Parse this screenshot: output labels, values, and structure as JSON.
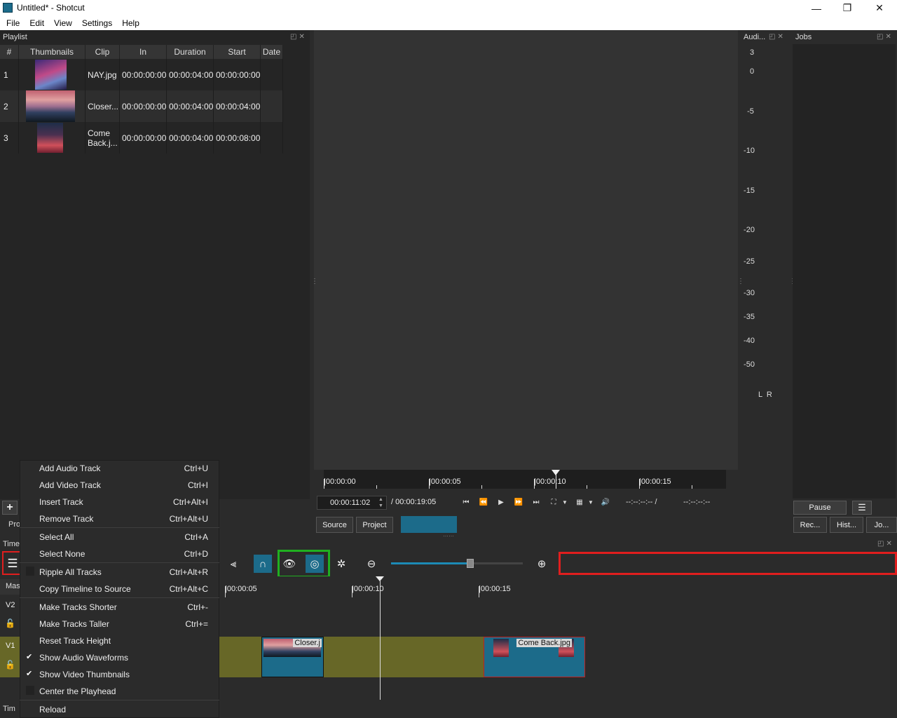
{
  "window": {
    "title": "Untitled* - Shotcut",
    "min": "—",
    "max": "❐",
    "close": "✕"
  },
  "menubar": [
    "File",
    "Edit",
    "View",
    "Settings",
    "Help"
  ],
  "playlist": {
    "title": "Playlist",
    "columns": [
      "#",
      "Thumbnails",
      "Clip",
      "In",
      "Duration",
      "Start",
      "Date"
    ],
    "rows": [
      {
        "num": "1",
        "clip": "NAY.jpg",
        "in": "00:00:00:00",
        "duration": "00:00:04:00",
        "start": "00:00:00:00"
      },
      {
        "num": "2",
        "clip": "Closer...",
        "in": "00:00:00:00",
        "duration": "00:00:04:00",
        "start": "00:00:04:00"
      },
      {
        "num": "3",
        "clip": "Come Back.j...",
        "in": "00:00:00:00",
        "duration": "00:00:04:00",
        "start": "00:00:08:00"
      }
    ],
    "add_label": "+",
    "tab_label": "Pro"
  },
  "audio_meter": {
    "title": "Audi...",
    "scale": [
      "3",
      "0",
      "-5",
      "-10",
      "-15",
      "-20",
      "-25",
      "-30",
      "-35",
      "-40",
      "-50"
    ],
    "channels": "L  R"
  },
  "jobs": {
    "title": "Jobs",
    "pause": "Pause",
    "menu": "☰",
    "tabs": [
      "Rec...",
      "Hist...",
      "Jo..."
    ]
  },
  "player": {
    "ruler_labels": [
      "|00:00:00",
      "|00:00:05",
      "|00:00:10",
      "|00:00:15"
    ],
    "position": "00:00:11:02",
    "duration": "/ 00:00:19:05",
    "in_out": "--:--:--:-- /",
    "out": "--:--:--:--",
    "tabs": [
      "Source",
      "Project"
    ]
  },
  "timeline": {
    "title": "Time",
    "master_label": "Mas",
    "tracks": [
      "V2",
      "V1"
    ],
    "ruler_labels": [
      "|00:00:05",
      "|00:00:10",
      "|00:00:15"
    ],
    "clips": [
      {
        "label": "Closer.j"
      },
      {
        "label": "Come Back.jpg"
      }
    ],
    "bottom_tab": "Tim",
    "zoom_value": 0.6
  },
  "context_menu": [
    {
      "label": "Add Audio Track",
      "shortcut": "Ctrl+U",
      "check": ""
    },
    {
      "label": "Add Video Track",
      "shortcut": "Ctrl+I",
      "check": ""
    },
    {
      "label": "Insert Track",
      "shortcut": "Ctrl+Alt+I",
      "check": ""
    },
    {
      "label": "Remove Track",
      "shortcut": "Ctrl+Alt+U",
      "check": ""
    },
    {
      "label": "Select All",
      "shortcut": "Ctrl+A",
      "check": ""
    },
    {
      "label": "Select None",
      "shortcut": "Ctrl+D",
      "check": ""
    },
    {
      "label": "Ripple All Tracks",
      "shortcut": "Ctrl+Alt+R",
      "check": "box"
    },
    {
      "label": "Copy Timeline to Source",
      "shortcut": "Ctrl+Alt+C",
      "check": ""
    },
    {
      "label": "Make Tracks Shorter",
      "shortcut": "Ctrl+-",
      "check": ""
    },
    {
      "label": "Make Tracks Taller",
      "shortcut": "Ctrl+=",
      "check": ""
    },
    {
      "label": "Reset Track Height",
      "shortcut": "",
      "check": ""
    },
    {
      "label": "Show Audio Waveforms",
      "shortcut": "",
      "check": "✔"
    },
    {
      "label": "Show Video Thumbnails",
      "shortcut": "",
      "check": "✔"
    },
    {
      "label": "Center the Playhead",
      "shortcut": "",
      "check": "box"
    },
    {
      "label": "Reload",
      "shortcut": "",
      "check": ""
    }
  ],
  "colors": {
    "highlight_red": "#e01e1e",
    "highlight_green": "#20b020",
    "accent_blue": "#1c6b8a",
    "clip_olive": "#676727"
  }
}
